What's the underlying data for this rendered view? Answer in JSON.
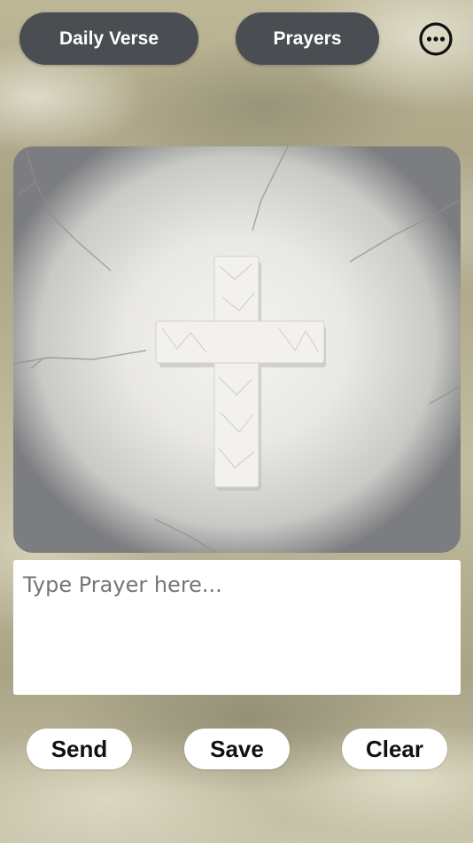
{
  "header": {
    "daily_verse_label": "Daily Verse",
    "prayers_label": "Prayers",
    "more_icon": "more-options-icon"
  },
  "main_image": {
    "subject": "cross-icon",
    "colors": {
      "cross": "#f2f1ed",
      "wall": "#ecebe6"
    }
  },
  "prayer_input": {
    "placeholder": "Type Prayer here...",
    "value": ""
  },
  "actions": {
    "send_label": "Send",
    "save_label": "Save",
    "clear_label": "Clear"
  },
  "colors": {
    "pill_bg": "#4a4d52",
    "action_bg": "#ffffff",
    "action_text": "#111111"
  }
}
